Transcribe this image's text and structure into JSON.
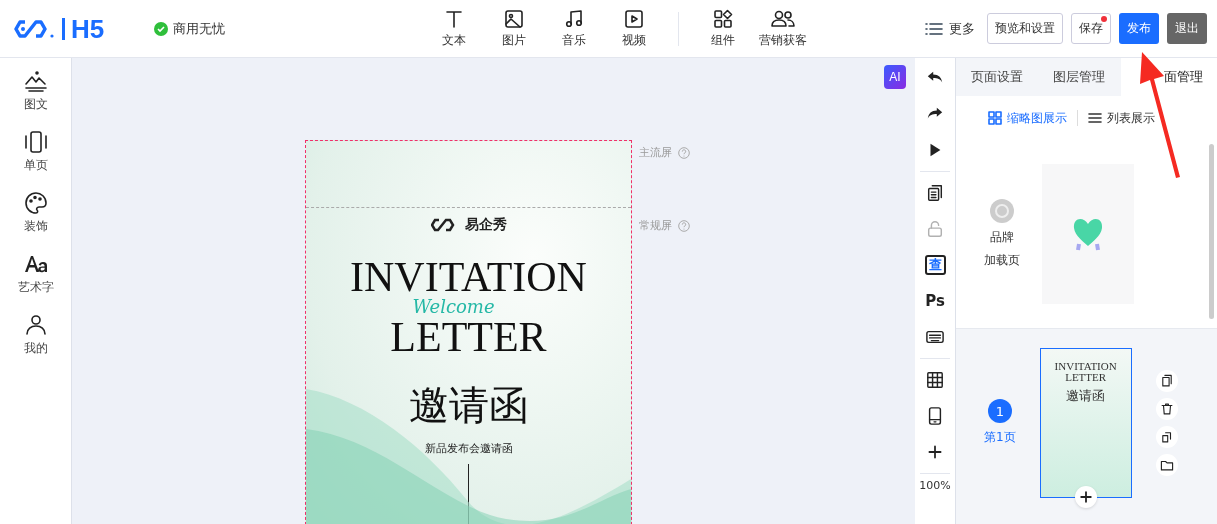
{
  "header": {
    "logo_text": "H5",
    "badge": "商用无忧",
    "tools": [
      {
        "label": "文本"
      },
      {
        "label": "图片"
      },
      {
        "label": "音乐"
      },
      {
        "label": "视频"
      }
    ],
    "tools_2": [
      {
        "label": "组件"
      },
      {
        "label": "营销获客"
      }
    ],
    "more": "更多",
    "buttons": [
      {
        "label": "预览和设置",
        "kind": "outline",
        "notification": false
      },
      {
        "label": "保存",
        "kind": "outline",
        "notification": true
      },
      {
        "label": "发布",
        "kind": "primary",
        "notification": false
      },
      {
        "label": "退出",
        "kind": "dark",
        "notification": false
      }
    ]
  },
  "sidebar": {
    "items": [
      {
        "label": "图文"
      },
      {
        "label": "单页"
      },
      {
        "label": "装饰"
      },
      {
        "label": "艺术字"
      },
      {
        "label": "我的"
      }
    ]
  },
  "canvas": {
    "ai_badge": "AI",
    "screen_markers": [
      {
        "label": "主流屏"
      },
      {
        "label": "常规屏"
      }
    ],
    "poster": {
      "brand": "易企秀",
      "title_line_1": "INVITATION",
      "script": "Welcome",
      "title_line_2": "LETTER",
      "heading": "邀请函",
      "subtitle": "新品发布会邀请函"
    }
  },
  "toolbar": {
    "groups": [
      [
        {
          "kind": "icon",
          "disabled": false
        },
        {
          "kind": "icon",
          "disabled": false
        },
        {
          "kind": "icon",
          "disabled": false
        }
      ],
      [
        {
          "kind": "icon",
          "disabled": false
        },
        {
          "kind": "icon",
          "disabled": true
        },
        {
          "kind": "scan",
          "text": "查",
          "disabled": false
        },
        {
          "kind": "text",
          "text": "Ps",
          "disabled": false
        },
        {
          "kind": "icon",
          "disabled": false
        }
      ],
      [
        {
          "kind": "icon",
          "disabled": false
        },
        {
          "kind": "icon",
          "disabled": false
        },
        {
          "kind": "icon",
          "disabled": false
        }
      ]
    ],
    "zoom": "100%"
  },
  "panel": {
    "tabs": [
      {
        "label": "页面设置",
        "selected": false
      },
      {
        "label": "图层管理",
        "selected": false
      },
      {
        "label": "面管理",
        "selected": true
      }
    ],
    "views": [
      {
        "label": "缩略图展示",
        "selected": true
      },
      {
        "label": "列表展示",
        "selected": false
      }
    ],
    "loading_page": {
      "label_1": "品牌",
      "label_2": "加载页"
    },
    "pages": [
      {
        "number": "1",
        "label": "第1页",
        "selected": true,
        "thumb": {
          "title_line_1": "INVITATION",
          "title_line_2": "LETTER",
          "heading": "邀请函"
        }
      }
    ]
  }
}
